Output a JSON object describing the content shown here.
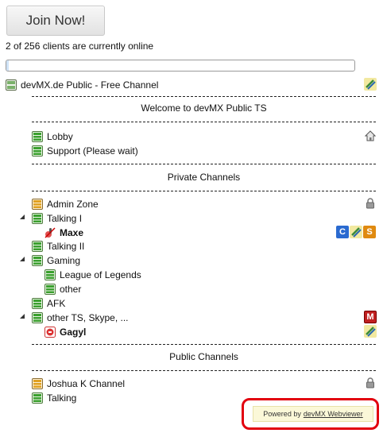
{
  "join_button": "Join Now!",
  "online_text": "2 of 256 clients are currently online",
  "online_fraction": 0.0078,
  "server": {
    "name": "devMX.de Public - Free Channel"
  },
  "spacers": {
    "welcome": "Welcome to devMX Public TS",
    "private": "Private Channels",
    "public": "Public Channels"
  },
  "channels": {
    "lobby": "Lobby",
    "support": "Support (Please wait)",
    "admin_zone": "Admin Zone",
    "talking_1": "Talking I",
    "talking_2": "Talking II",
    "gaming": "Gaming",
    "lol": "League of Legends",
    "other": "other",
    "afk": "AFK",
    "other_ts": "other TS, Skype, ...",
    "joshua": "Joshua K Channel",
    "talking": "Talking"
  },
  "clients": {
    "maxe": "Maxe",
    "gagyl": "Gagyl"
  },
  "badges": {
    "c": "C",
    "s": "S",
    "m": "M"
  },
  "footer": {
    "powered_by": "Powered by",
    "link": "devMX Webviewer"
  },
  "colors": {
    "channel_green": "#3a9a2e",
    "channel_orange": "#e0a020",
    "highlight_border": "#e2000f"
  }
}
